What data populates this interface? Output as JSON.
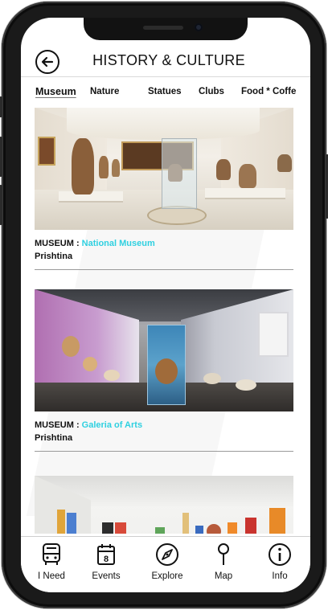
{
  "header": {
    "title": "HISTORY & CULTURE",
    "back_icon": "arrow-left-icon"
  },
  "tabs": [
    {
      "label": "Museum",
      "active": true
    },
    {
      "label": "Nature",
      "active": false
    },
    {
      "label": "Statues",
      "active": false
    },
    {
      "label": "Clubs",
      "active": false
    },
    {
      "label": "Food * Coffe",
      "active": false
    }
  ],
  "cards": [
    {
      "category": "MUSEUM : ",
      "name": "National Museum",
      "city": "Prishtina"
    },
    {
      "category": "MUSEUM : ",
      "name": "Galeria of Arts",
      "city": "Prishtina"
    },
    {
      "category": "",
      "name": "",
      "city": ""
    }
  ],
  "bottom_nav": [
    {
      "label": "I Need",
      "icon": "bus-icon"
    },
    {
      "label": "Events",
      "icon": "calendar-icon",
      "badge": "8"
    },
    {
      "label": "Explore",
      "icon": "compass-icon"
    },
    {
      "label": "Map",
      "icon": "map-pin-icon"
    },
    {
      "label": "Info",
      "icon": "info-icon"
    }
  ],
  "colors": {
    "accent": "#2fd0e0",
    "text": "#111111",
    "frame": "#1a1a1a"
  }
}
